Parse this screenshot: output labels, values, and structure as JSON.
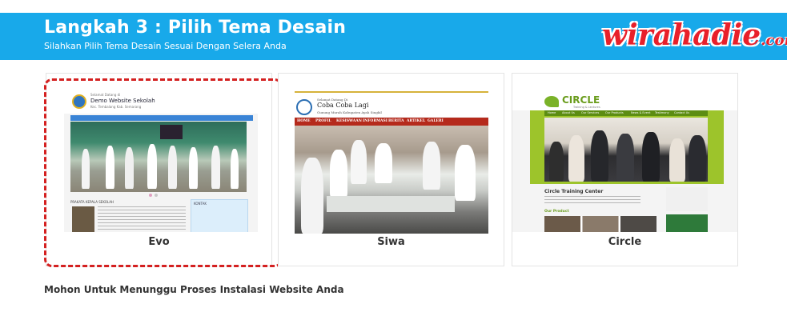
{
  "header": {
    "title": "Langkah 3 : Pilih Tema Desain",
    "subtitle": "Silahkan Pilih Tema Desain Sesuai Dengan Selera Anda",
    "brand_main": "wirahadie",
    "brand_suffix": ".com",
    "background_color": "#18a9ea"
  },
  "themes": [
    {
      "name": "Evo",
      "selected": true,
      "preview": {
        "small_text": "Selamat Datang di",
        "site_name": "Demo Website Sekolah",
        "address": "Kec. Tembalang Kab. Semarang",
        "section_left": "PRAKATA KEPALA SEKOLAH",
        "section_right": "KONTAK"
      }
    },
    {
      "name": "Siwa",
      "selected": false,
      "preview": {
        "small_text": "Selamat Datang Di",
        "site_name": "Coba Coba Lagi",
        "address": "Gunung Murah Kabupaten Ayah Singkil",
        "nav": [
          "HOME",
          "PROFIL",
          "KESISWAAN",
          "INFORMASI",
          "BERITA",
          "ARTIKEL",
          "GALERI"
        ]
      }
    },
    {
      "name": "Circle",
      "selected": false,
      "preview": {
        "site_name": "CIRCLE",
        "tagline": "Training & Lectures",
        "nav": [
          "Home",
          "About Us",
          "Our Services",
          "Our Products",
          "News & Event",
          "Testimony",
          "Contact Us"
        ],
        "content_title": "Circle Training Center",
        "products_title": "Our Product"
      }
    }
  ],
  "footer": {
    "message": "Mohon Untuk Menunggu Proses Instalasi Website Anda"
  },
  "colors": {
    "selection_border": "#d42020",
    "siwa_nav": "#b52a1c",
    "circle_green": "#9dc42b"
  }
}
